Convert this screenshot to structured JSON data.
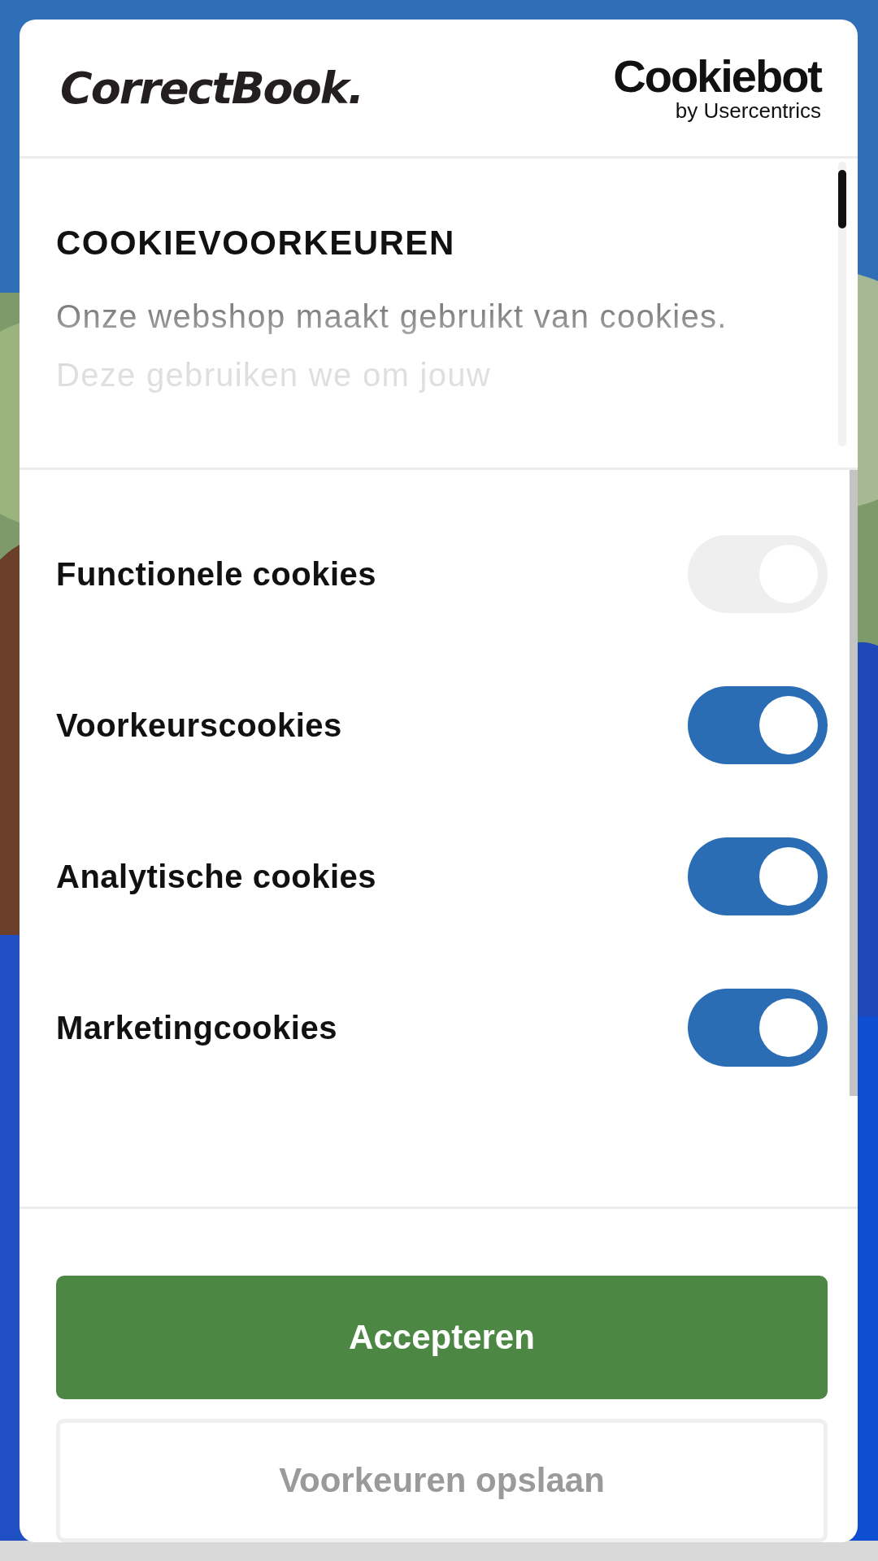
{
  "header": {
    "logo": "CorrectBook.",
    "partner_logo": {
      "name": "Cookiebot",
      "byline": "by Usercentrics"
    }
  },
  "intro": {
    "title": "COOKIEVOORKEUREN",
    "text": "Onze webshop maakt gebruikt van cookies. Deze gebruiken we om jouw"
  },
  "toggles": [
    {
      "label": "Functionele cookies",
      "on": true,
      "disabled": true
    },
    {
      "label": "Voorkeurscookies",
      "on": true,
      "disabled": false
    },
    {
      "label": "Analytische cookies",
      "on": true,
      "disabled": false
    },
    {
      "label": "Marketingcookies",
      "on": true,
      "disabled": false
    }
  ],
  "buttons": [
    {
      "label": "Accepteren",
      "kind": "primary"
    },
    {
      "label": "Voorkeuren opslaan",
      "kind": "secondary"
    }
  ]
}
